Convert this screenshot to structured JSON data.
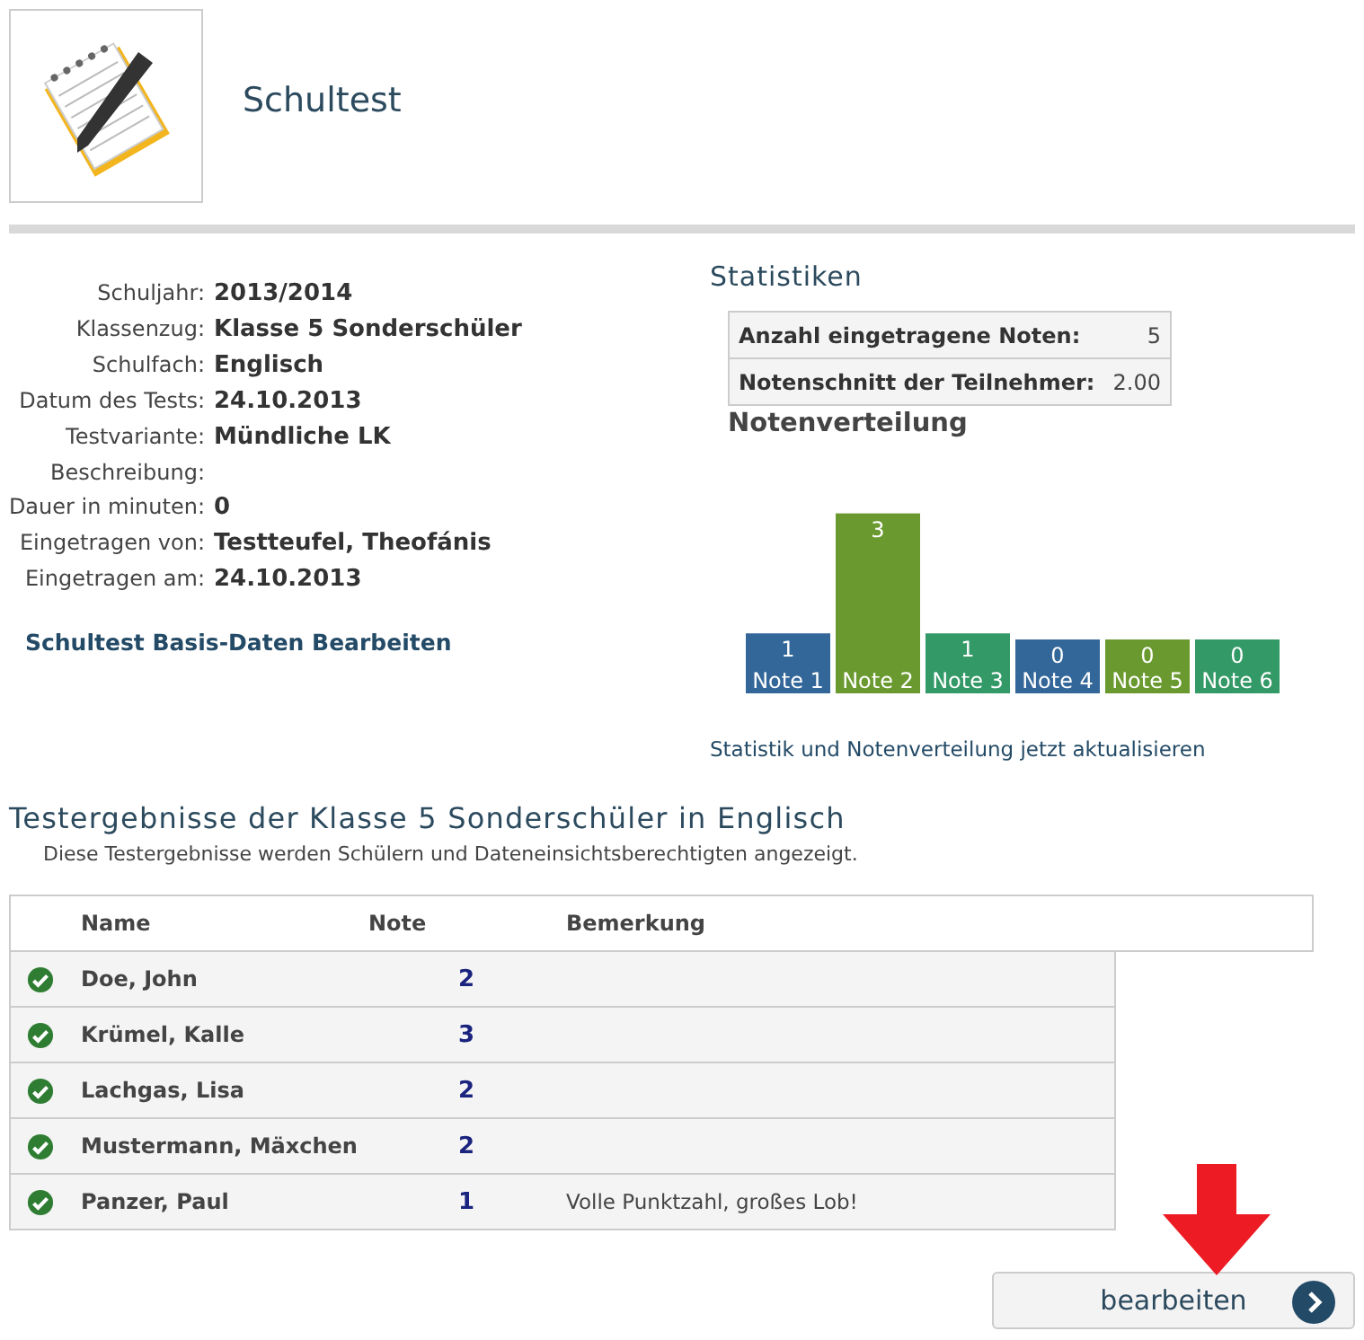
{
  "header": {
    "title": "Schultest"
  },
  "details": [
    {
      "label": "Schuljahr:",
      "value": "2013/2014"
    },
    {
      "label": "Klassenzug:",
      "value": "Klasse 5 Sonderschüler"
    },
    {
      "label": "Schulfach:",
      "value": "Englisch"
    },
    {
      "label": "Datum des Tests:",
      "value": "24.10.2013"
    },
    {
      "label": "Testvariante:",
      "value": "Mündliche LK"
    },
    {
      "label": "Beschreibung:"
    },
    {
      "label": "Dauer in minuten:",
      "value": "0"
    },
    {
      "label": "Eingetragen von:",
      "value": "Testteufel, Theofánis"
    },
    {
      "label": "Eingetragen am:",
      "value": "24.10.2013"
    }
  ],
  "edit_link": "Schultest Basis-Daten Bearbeiten",
  "statistics": {
    "title": "Statistiken",
    "rows": [
      {
        "label": "Anzahl eingetragene Noten:",
        "value": "5"
      },
      {
        "label": "Notenschnitt der Teilnehmer:",
        "value": "2.00"
      }
    ],
    "distribution_title": "Notenverteilung",
    "chart_data": {
      "type": "bar",
      "categories": [
        "Note 1",
        "Note 2",
        "Note 3",
        "Note 4",
        "Note 5",
        "Note 6"
      ],
      "values": [
        1,
        3,
        1,
        0,
        0,
        0
      ],
      "data_labels": true
    },
    "refresh_link": "Statistik und Notenverteilung jetzt aktualisieren"
  },
  "results": {
    "title": "Testergebnisse der Klasse 5 Sonderschüler in Englisch",
    "subtitle": "Diese Testergebnisse werden Schülern und Dateneinsichtsberechtigten angezeigt.",
    "columns": [
      "Name",
      "Note",
      "Bemerkung"
    ],
    "rows": [
      {
        "name": "Doe, John",
        "note": "2"
      },
      {
        "name": "Krümel, Kalle",
        "note": "3"
      },
      {
        "name": "Lachgas, Lisa",
        "note": "2"
      },
      {
        "name": "Mustermann, Mäxchen",
        "note": "2"
      },
      {
        "name": "Panzer, Paul",
        "note": "1",
        "remark": "Volle Punktzahl, großes Lob!"
      }
    ]
  },
  "button": "bearbeiten"
}
